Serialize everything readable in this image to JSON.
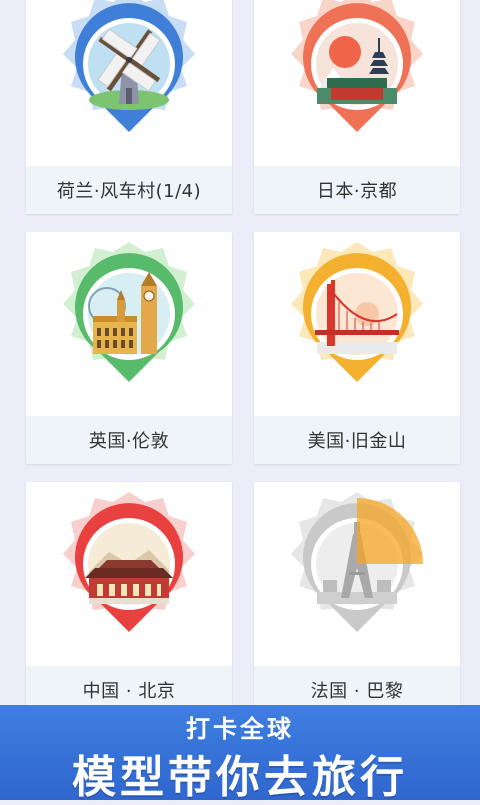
{
  "cards": [
    {
      "label": "荷兰·风车村(1/4)",
      "icon": "windmill-icon",
      "color": "#4a8fe0"
    },
    {
      "label": "日本·京都",
      "icon": "pagoda-icon",
      "color": "#f07a5f"
    },
    {
      "label": "英国·伦敦",
      "icon": "big-ben-icon",
      "color": "#5cbf74"
    },
    {
      "label": "美国·旧金山",
      "icon": "golden-gate-bridge-icon",
      "color": "#f4b63a"
    },
    {
      "label": "中国 · 北京",
      "icon": "forbidden-city-icon",
      "color": "#e84c4c"
    },
    {
      "label": "法国 · 巴黎",
      "icon": "eiffel-tower-icon",
      "color": "#cccccc"
    }
  ],
  "banner": {
    "subtitle": "打卡全球",
    "title": "模型带你去旅行"
  },
  "colors": {
    "background": "#ecedf8",
    "banner": "#3a78dc",
    "progress": "#f5a623"
  },
  "paris_progress": 0.25
}
